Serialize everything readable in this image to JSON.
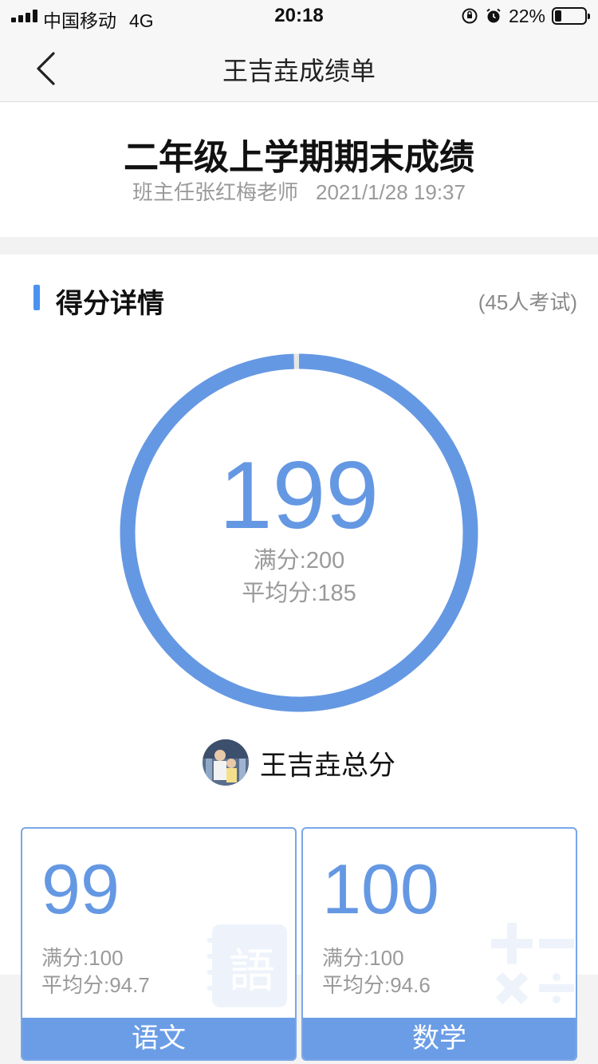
{
  "status_bar": {
    "carrier": "中国移动",
    "network": "4G",
    "time": "20:18",
    "battery_percent": "22%",
    "battery_level": 0.22
  },
  "nav": {
    "title": "王吉垚成绩单"
  },
  "exam": {
    "title": "二年级上学期期末成绩",
    "teacher": "班主任张红梅老师",
    "datetime": "2021/1/28 19:37"
  },
  "section": {
    "title": "得分详情",
    "exam_count": "(45人考试)"
  },
  "total": {
    "score": "199",
    "full_label": "满分:200",
    "avg_label": "平均分:185",
    "score_value": 199,
    "full_value": 200
  },
  "student": {
    "label": "王吉垚总分"
  },
  "subjects": [
    {
      "name": "语文",
      "score": "99",
      "full_label": "满分:100",
      "avg_label": "平均分:94.7"
    },
    {
      "name": "数学",
      "score": "100",
      "full_label": "满分:100",
      "avg_label": "平均分:94.6"
    }
  ],
  "colors": {
    "accent": "#4c93f0",
    "ring": "#6598e3",
    "card_footer": "#6b9de6"
  }
}
